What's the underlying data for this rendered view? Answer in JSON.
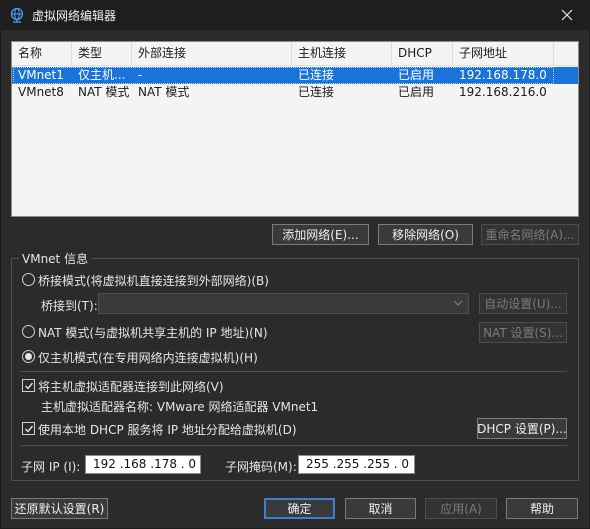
{
  "window": {
    "title": "虚拟网络编辑器",
    "icon": "network-globe-icon"
  },
  "table": {
    "columns": [
      "名称",
      "类型",
      "外部连接",
      "主机连接",
      "DHCP",
      "子网地址"
    ],
    "rows": [
      {
        "name": "VMnet1",
        "type": "仅主机...",
        "external": "-",
        "host": "已连接",
        "dhcp": "已启用",
        "subnet": "192.168.178.0",
        "selected": true
      },
      {
        "name": "VMnet8",
        "type": "NAT 模式",
        "external": "NAT 模式",
        "host": "已连接",
        "dhcp": "已启用",
        "subnet": "192.168.216.0",
        "selected": false
      }
    ]
  },
  "table_buttons": {
    "add": "添加网络(E)...",
    "remove": "移除网络(O)",
    "rename": "重命名网络(A)..."
  },
  "vmnet_info": {
    "group_label": "VMnet 信息",
    "bridged_label": "桥接模式(将虚拟机直接连接到外部网络)(B)",
    "bridged_to_label": "桥接到(T):",
    "bridged_to_value": "",
    "auto_settings": "自动设置(U)...",
    "nat_label": "NAT 模式(与虚拟机共享主机的 IP 地址)(N)",
    "nat_settings": "NAT 设置(S)...",
    "hostonly_label": "仅主机模式(在专用网络内连接虚拟机)(H)",
    "selected_mode": "hostonly",
    "connect_adapter_label": "将主机虚拟适配器连接到此网络(V)",
    "connect_adapter_checked": true,
    "adapter_name_label": "主机虚拟适配器名称: VMware 网络适配器 VMnet1",
    "use_dhcp_label": "使用本地 DHCP 服务将 IP 地址分配给虚拟机(D)",
    "use_dhcp_checked": true,
    "dhcp_settings": "DHCP 设置(P)...",
    "subnet_ip_label": "子网 IP (I):",
    "subnet_ip_value": "192 .168 .178 . 0",
    "subnet_mask_label": "子网掩码(M):",
    "subnet_mask_value": "255 .255 .255 . 0"
  },
  "footer": {
    "restore_defaults": "还原默认设置(R)",
    "ok": "确定",
    "cancel": "取消",
    "apply": "应用(A)",
    "help": "帮助"
  },
  "colors": {
    "selection": "#1a73d9",
    "dialog_bg": "#2b2b2b",
    "default_button_border": "#3a7fd4"
  }
}
